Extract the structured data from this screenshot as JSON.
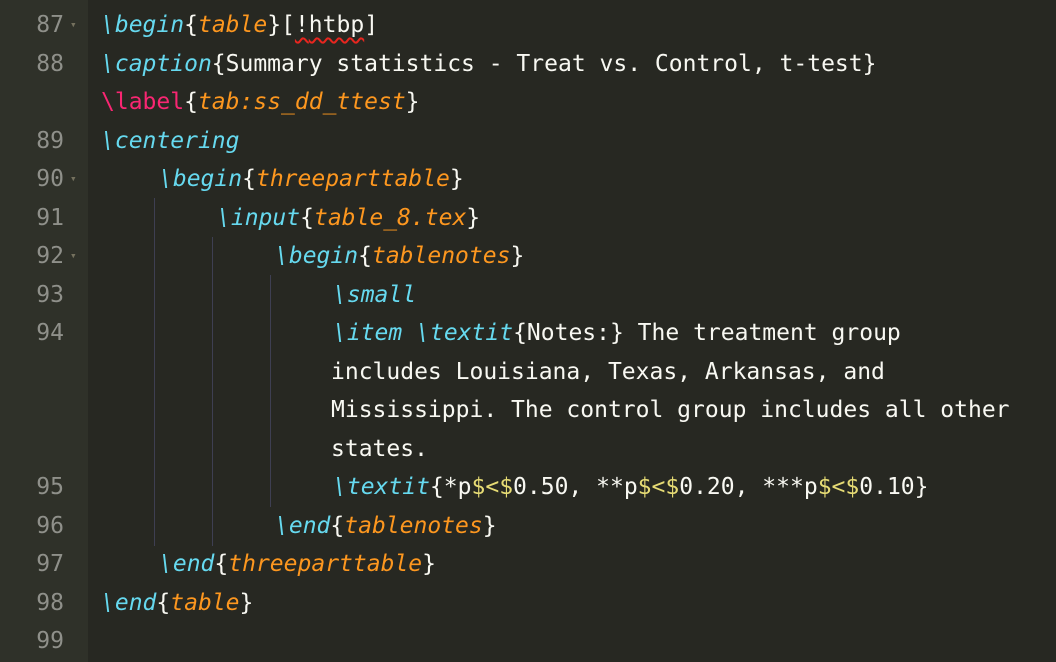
{
  "editor": {
    "gutter": {
      "line_numbers": [
        "87",
        "88",
        "89",
        "90",
        "91",
        "92",
        "93",
        "94",
        "95",
        "96",
        "97",
        "98",
        "99"
      ],
      "fold_glyph": "▾"
    },
    "lines": {
      "l87": {
        "bs": "\\",
        "cmd": "begin",
        "lb": "{",
        "arg": "table",
        "rb": "}",
        "bracket_open": "[",
        "excl": "!",
        "opt": "htbp",
        "bracket_close": "]"
      },
      "l88": {
        "bs": "\\",
        "cmd": "caption",
        "text": "{Summary statistics - Treat vs. Control, t-test}"
      },
      "l88b": {
        "cmd": "\\label",
        "lb": "{",
        "arg": "tab:ss_dd_ttest",
        "rb": "}"
      },
      "l89": {
        "bs": "\\",
        "cmd": "centering"
      },
      "l90": {
        "bs": "\\",
        "cmd": "begin",
        "lb": "{",
        "arg": "threeparttable",
        "rb": "}"
      },
      "l91": {
        "bs": "\\",
        "cmd": "input",
        "lb": "{",
        "arg": "table_8.tex",
        "rb": "}"
      },
      "l92": {
        "bs": "\\",
        "cmd": "begin",
        "lb": "{",
        "arg": "tablenotes",
        "rb": "}"
      },
      "l93": {
        "bs": "\\",
        "cmd": "small"
      },
      "l94": {
        "bs1": "\\",
        "cmd1": "item",
        "space": " ",
        "bs2": "\\",
        "cmd2": "textit",
        "text": "{Notes:} The treatment group",
        "wrap1": "includes Louisiana, Texas, Arkansas, and",
        "wrap2": "Mississippi. The control group includes all other",
        "wrap3": "states."
      },
      "l95": {
        "bs": "\\",
        "cmd": "textit",
        "t1": "{*p",
        "d1": "$<$",
        "t2": "0.50, **p",
        "d2": "$<$",
        "t3": "0.20, ***p",
        "d3": "$<$",
        "t4": "0.10}"
      },
      "l96": {
        "bs": "\\",
        "cmd": "end",
        "lb": "{",
        "arg": "tablenotes",
        "rb": "}"
      },
      "l97": {
        "bs": "\\",
        "cmd": "end",
        "lb": "{",
        "arg": "threeparttable",
        "rb": "}"
      },
      "l98": {
        "bs": "\\",
        "cmd": "end",
        "lb": "{",
        "arg": "table",
        "rb": "}"
      }
    },
    "colors": {
      "background": "#272822",
      "gutter": "#2f3129",
      "command": "#66d9ef",
      "argument": "#fd971f",
      "label": "#f92672",
      "math": "#e6db74",
      "text": "#f8f8f2",
      "line_number": "#8f908a"
    }
  }
}
